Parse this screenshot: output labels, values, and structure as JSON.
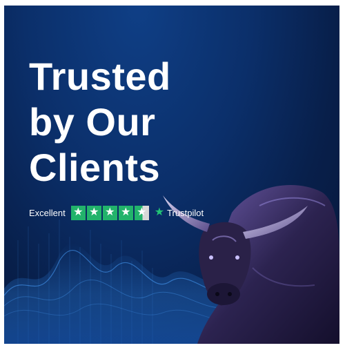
{
  "headline": {
    "lines": [
      "Trusted",
      "by Our",
      "Clients"
    ]
  },
  "rating": {
    "label": "Excellent",
    "stars": 4.5,
    "provider": "Trustpilot"
  },
  "colors": {
    "background": "#0b2f6a",
    "star_green": "#22b36b",
    "text": "#ffffff"
  },
  "icons": {
    "rating_star": "star-icon",
    "provider_logo": "trustpilot-star-icon"
  }
}
